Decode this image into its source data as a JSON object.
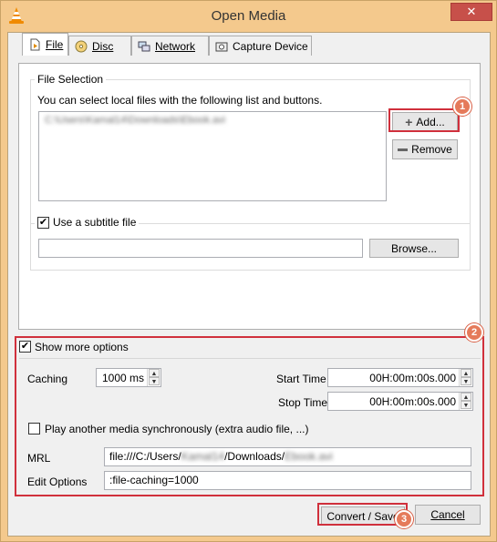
{
  "window": {
    "title": "Open Media",
    "close_glyph": "✕"
  },
  "tabs": [
    {
      "label": "File",
      "icon": "file-icon",
      "active": true
    },
    {
      "label": "Disc",
      "icon": "disc-icon",
      "active": false
    },
    {
      "label": "Network",
      "icon": "network-icon",
      "active": false
    },
    {
      "label": "Capture Device",
      "icon": "capture-device-icon",
      "active": false
    }
  ],
  "file_selection": {
    "legend": "File Selection",
    "hint": "You can select local files with the following list and buttons.",
    "files": [
      "C:\\Users\\Kamal14\\Downloads\\Ebook.avi"
    ],
    "add_button": "Add...",
    "remove_button": "Remove"
  },
  "subtitle": {
    "checkbox_label": "Use a subtitle file",
    "checked": true,
    "path_value": "",
    "browse_button": "Browse..."
  },
  "options": {
    "show_more_label": "Show more options",
    "show_more_checked": true,
    "caching_label": "Caching",
    "caching_value": "1000 ms",
    "start_time_label": "Start Time",
    "start_time_value": "00H:00m:00s.000",
    "stop_time_label": "Stop Time",
    "stop_time_value": "00H:00m:00s.000",
    "play_another_label": "Play another media synchronously (extra audio file, ...)",
    "play_another_checked": false,
    "mrl_label": "MRL",
    "mrl_prefix": "file:///C:/Users/",
    "mrl_user": "Kamal14",
    "mrl_mid": "/Downloads/",
    "mrl_file": "Ebook.avi",
    "edit_options_label": "Edit Options",
    "edit_options_value": ":file-caching=1000"
  },
  "footer": {
    "convert_save_button": "Convert / Save",
    "cancel_button": "Cancel"
  },
  "annotations": {
    "badge_1": "1",
    "badge_2": "2",
    "badge_3": "3",
    "highlight_color": "#d0303c"
  },
  "colors": {
    "title_bar": "#f4c98d",
    "close_button": "#c7504a",
    "badge": "#e57a5a"
  }
}
